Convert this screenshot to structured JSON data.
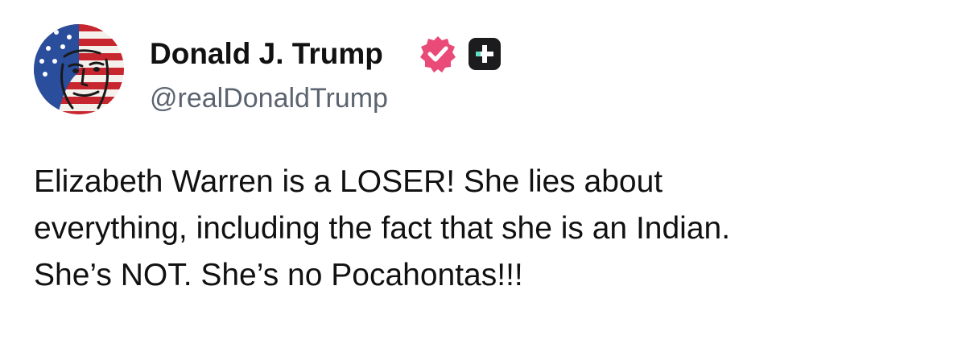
{
  "author": {
    "display_name": "Donald J. Trump",
    "handle": "@realDonaldTrump",
    "avatar_icon": "flag-portrait-avatar",
    "verified_icon": "verified-badge-icon",
    "verified_color": "#e94a78",
    "plus_icon": "plus-badge-icon",
    "plus_color": "#1c1c1e",
    "plus_accent": "#5ce0c6"
  },
  "post": {
    "line1": "Elizabeth Warren is a LOSER! She lies about",
    "line2": "everything, including the fact that she is an Indian.",
    "line3": "She’s NOT. She’s no Pocahontas!!!"
  }
}
